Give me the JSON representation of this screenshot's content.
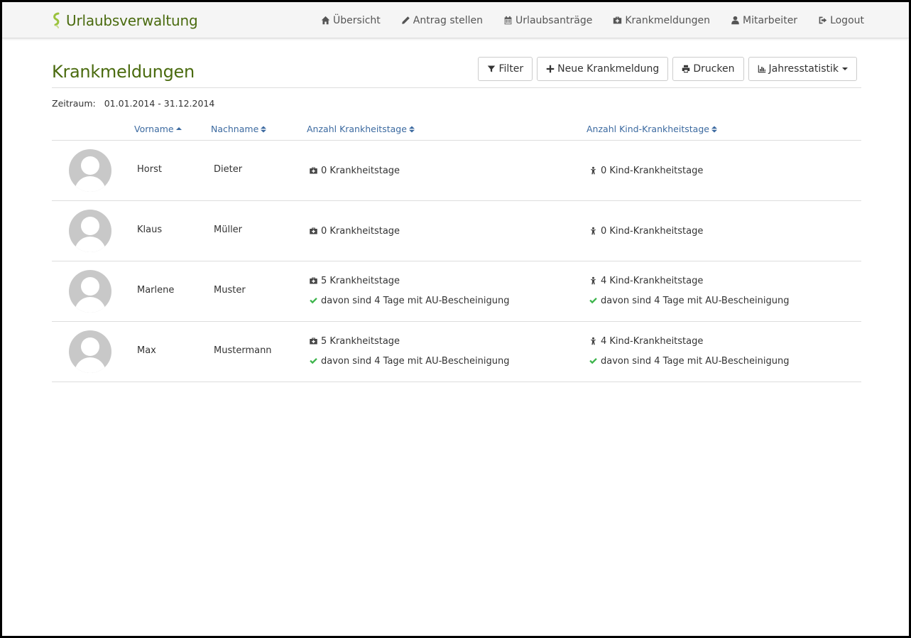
{
  "app": {
    "title": "Urlaubsverwaltung"
  },
  "nav": {
    "items": [
      {
        "label": "Übersicht",
        "icon": "home-icon"
      },
      {
        "label": "Antrag stellen",
        "icon": "pencil-icon"
      },
      {
        "label": "Urlaubsanträge",
        "icon": "calendar-icon"
      },
      {
        "label": "Krankmeldungen",
        "icon": "medkit-icon"
      },
      {
        "label": "Mitarbeiter",
        "icon": "user-icon"
      },
      {
        "label": "Logout",
        "icon": "sign-out-icon"
      }
    ]
  },
  "page": {
    "title": "Krankmeldungen",
    "toolbar": {
      "filter": "Filter",
      "new_sick_note": "Neue Krankmeldung",
      "print": "Drucken",
      "statistics": "Jahresstatistik"
    },
    "period": {
      "label": "Zeitraum:",
      "value": "01.01.2014 - 31.12.2014"
    }
  },
  "table": {
    "columns": {
      "firstname": "Vorname",
      "lastname": "Nachname",
      "sick_days": "Anzahl Krankheitstage",
      "child_sick_days": "Anzahl Kind-Krankheitstage"
    },
    "rows": [
      {
        "firstname": "Horst",
        "lastname": "Dieter",
        "sick_days": "0 Krankheitstage",
        "sick_au": "",
        "child_days": "0 Kind-Krankheitstage",
        "child_au": ""
      },
      {
        "firstname": "Klaus",
        "lastname": "Müller",
        "sick_days": "0 Krankheitstage",
        "sick_au": "",
        "child_days": "0 Kind-Krankheitstage",
        "child_au": ""
      },
      {
        "firstname": "Marlene",
        "lastname": "Muster",
        "sick_days": "5 Krankheitstage",
        "sick_au": "davon sind 4 Tage mit AU-Bescheinigung",
        "child_days": "4 Kind-Krankheitstage",
        "child_au": "davon sind 4 Tage mit AU-Bescheinigung"
      },
      {
        "firstname": "Max",
        "lastname": "Mustermann",
        "sick_days": "5 Krankheitstage",
        "sick_au": "davon sind 4 Tage mit AU-Bescheinigung",
        "child_days": "4 Kind-Krankheitstage",
        "child_au": "davon sind 4 Tage mit AU-Bescheinigung"
      }
    ]
  },
  "colors": {
    "brand": "#4a6b0f",
    "link": "#3c6aa0",
    "check": "#3cb44b"
  }
}
